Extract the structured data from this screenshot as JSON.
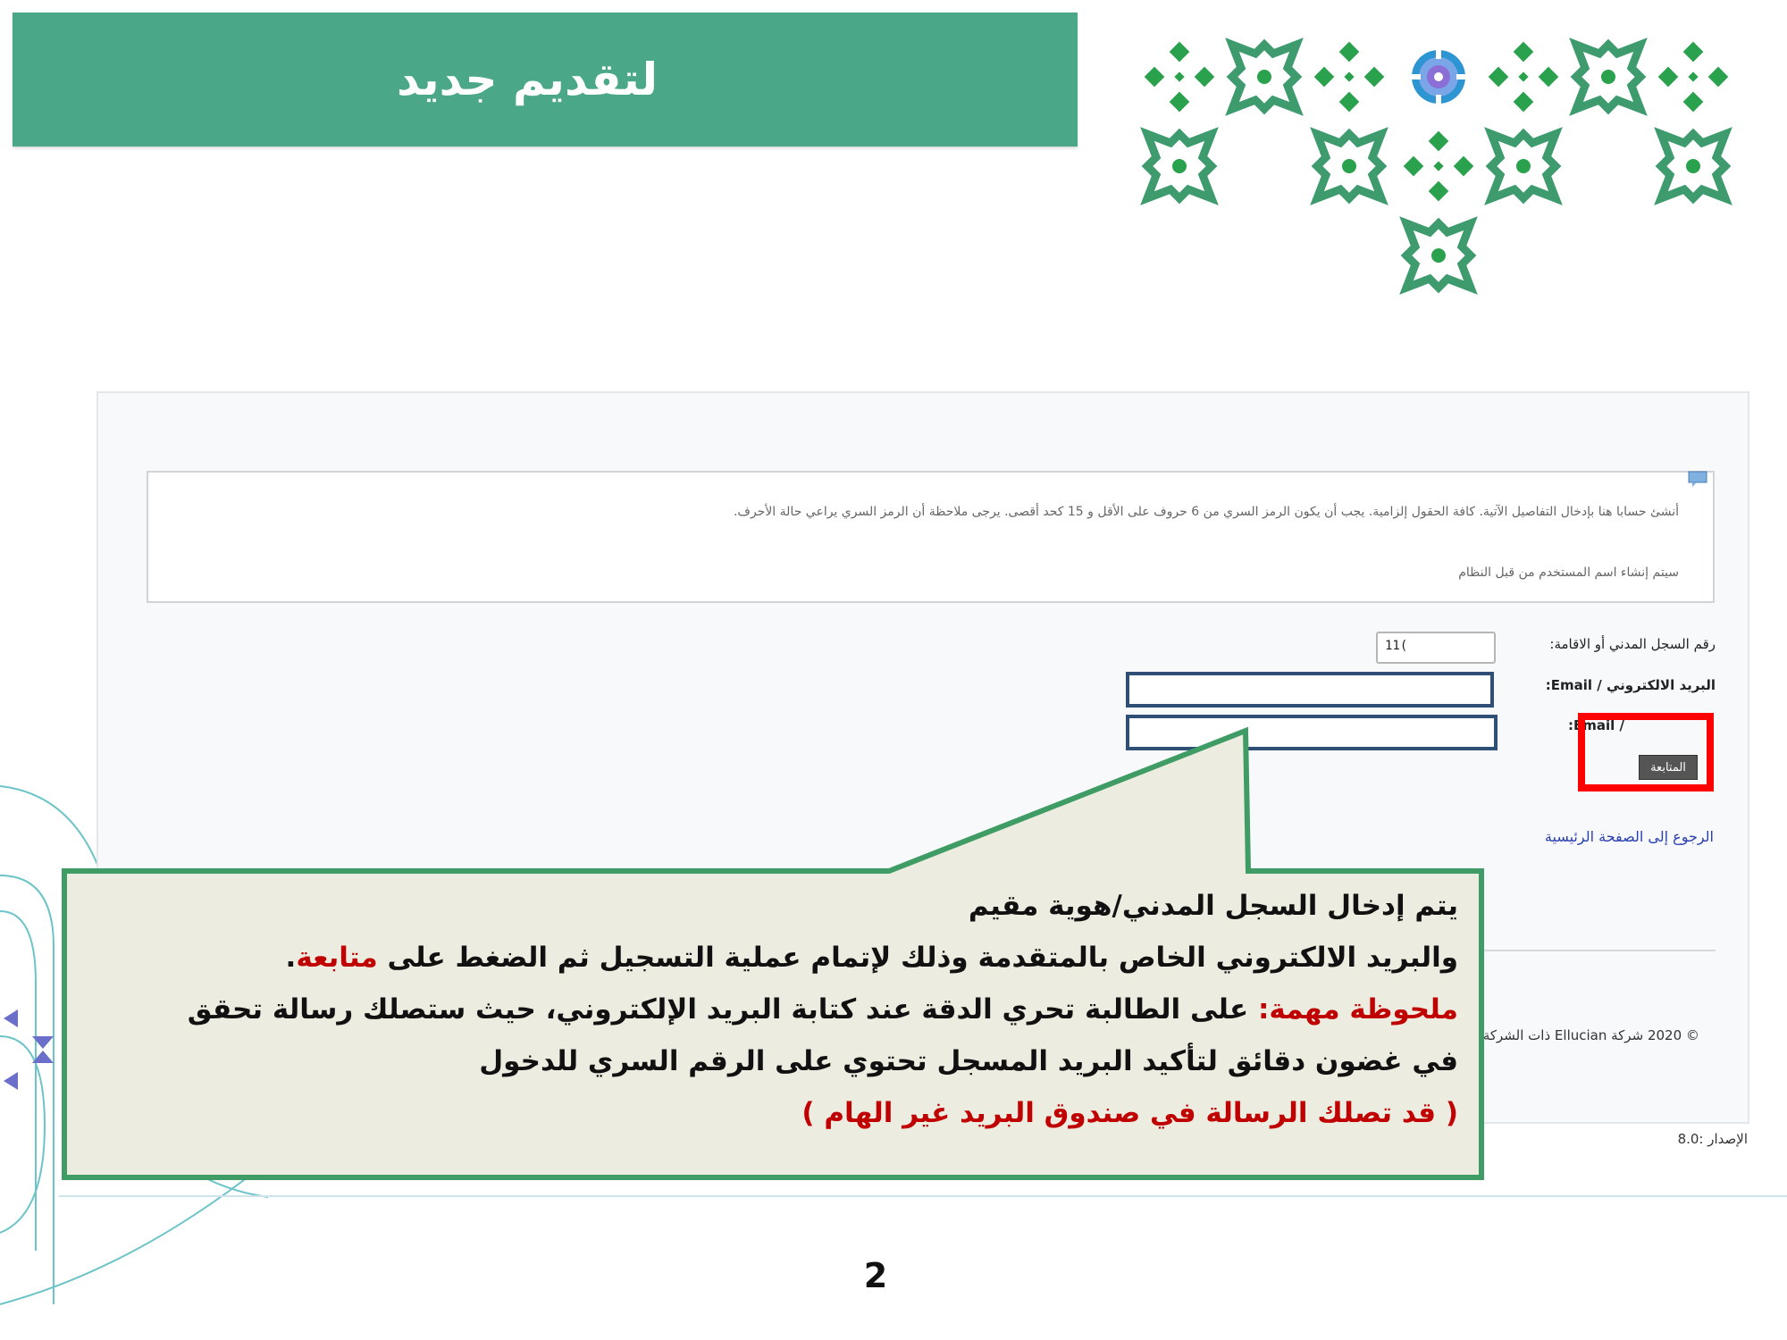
{
  "slide": {
    "title": "لتقديم جديد",
    "page_number": "2",
    "accent_color": "#4aa888",
    "ornament_icon": "sadu-star-ornament-icon"
  },
  "form": {
    "info_line1": "أنشئ حسابا هنا بإدخال التفاصيل الآتية. كافة الحقول إلزامية. يجب أن يكون الرمز السري من 6 حروف على الأقل و 15 كحد أقصى. يرجى ملاحظة أن الرمز السري يراعي حالة الأحرف.",
    "info_line2": "سيتم إنشاء اسم المستخدم من قبل النظام",
    "id_label": "رقم السجل المدني أو الاقامة:",
    "id_value": "11(",
    "email_label": "البريد الالكتروني / Email:",
    "confirm_email_label": "/ Email:",
    "continue_button": "المتابعة",
    "home_link": "الرجوع إلى الصفحة الرئيسية",
    "copyright": "© 2020 شركة Ellucian ذات الشركة ال",
    "version": "الإصدار :8.0"
  },
  "callout": {
    "line1": "يتم إدخال السجل المدني/هوية مقيم",
    "line2_a": "والبريد الالكتروني الخاص بالمتقدمة وذلك لإتمام عملية التسجيل ثم الضغط على ",
    "line2_red": "متابعة",
    "line2_b": ".",
    "line3_red": "ملحوظة مهمة:",
    "line3_b": " على الطالبة تحري الدقة عند كتابة البريد الإلكتروني، حيث ستصلك رسالة تحقق",
    "line4": "في غضون دقائق لتأكيد البريد المسجل تحتوي على الرقم السري للدخول",
    "line5_red": "( قد تصلك الرسالة في صندوق البريد غير الهام )"
  }
}
